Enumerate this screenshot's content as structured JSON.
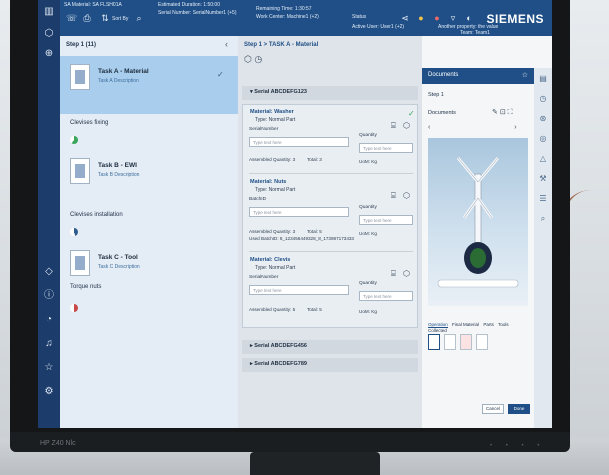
{
  "header": {
    "material": "SA Material: SA FLSH01A",
    "estimated_duration": "Estimated Duration: 1:50:00",
    "serial_number": "Serial Number: SerialNumber1 (+5)",
    "remaining_time": "Remaining Time: 1:30:57",
    "work_center": "Work Center: Machine1 (+2)",
    "status": "Status",
    "active_user": "Active User: User1 (+2)",
    "another_property": "Another property: the value",
    "team": "Team: Team1",
    "sort_by": "Sort By",
    "brand": "SIEMENS"
  },
  "tasklist": {
    "step_header": "Step 1 (11)",
    "tasks": [
      {
        "title": "Task A - Material",
        "description": "Task A Description",
        "section": "Clevises fixing"
      },
      {
        "title": "Task B - EWI",
        "description": "Task B Description",
        "section": "Clevises installation"
      },
      {
        "title": "Task C - Tool",
        "description": "Task C Description",
        "section": "Torque nuts"
      }
    ]
  },
  "middle": {
    "breadcrumb": "Step 1 > TASK A - Material",
    "serial_open": "Serial ABCDEFG123",
    "materials": [
      {
        "title": "Material: Washer",
        "type": "Type: Normal Part",
        "field_label": "SerialNumber",
        "field_placeholder": "Type text here",
        "qty_label": "Quantity",
        "qty_placeholder": "Type text here",
        "assembled": "Assembled Quantity: 3",
        "total": "Total: 3",
        "uom": "UoM: Kg"
      },
      {
        "title": "Material: Nuts",
        "type": "Type: Normal Part",
        "field_label": "BatchID",
        "field_placeholder": "Type text here",
        "qty_label": "Quantity",
        "qty_placeholder": "Type text here",
        "assembled": "Assembled Quantity: 3",
        "total": "Total: 5",
        "used": "Used BatchID: 8_123456449328_8_173987173433",
        "uom": "UoM: Kg"
      },
      {
        "title": "Material: Clevis",
        "type": "Type: Normal Part",
        "field_label": "SerialNumber",
        "field_placeholder": "Type text here",
        "qty_label": "Quantity",
        "qty_placeholder": "Type text here",
        "assembled": "Assembled Quantity: 5",
        "total": "Total: 5",
        "uom": "UoM: Kg"
      }
    ],
    "serials_collapsed": [
      "Serial ABCDEFG456",
      "Serial ABCDEFG789"
    ]
  },
  "docs": {
    "title": "Documents",
    "step": "Step 1",
    "sub": "Documents",
    "tabs": [
      "Operation",
      "Final Material",
      "Parts",
      "Tools",
      "Collected"
    ],
    "cancel": "Cancel",
    "done": "Done"
  },
  "monitor_model": "HP Z40 Nlc",
  "colors": {
    "rail": "#1c3d6b",
    "header": "#1f4f86",
    "active_task": "#a9cdec",
    "check_green": "#3aa65a"
  }
}
